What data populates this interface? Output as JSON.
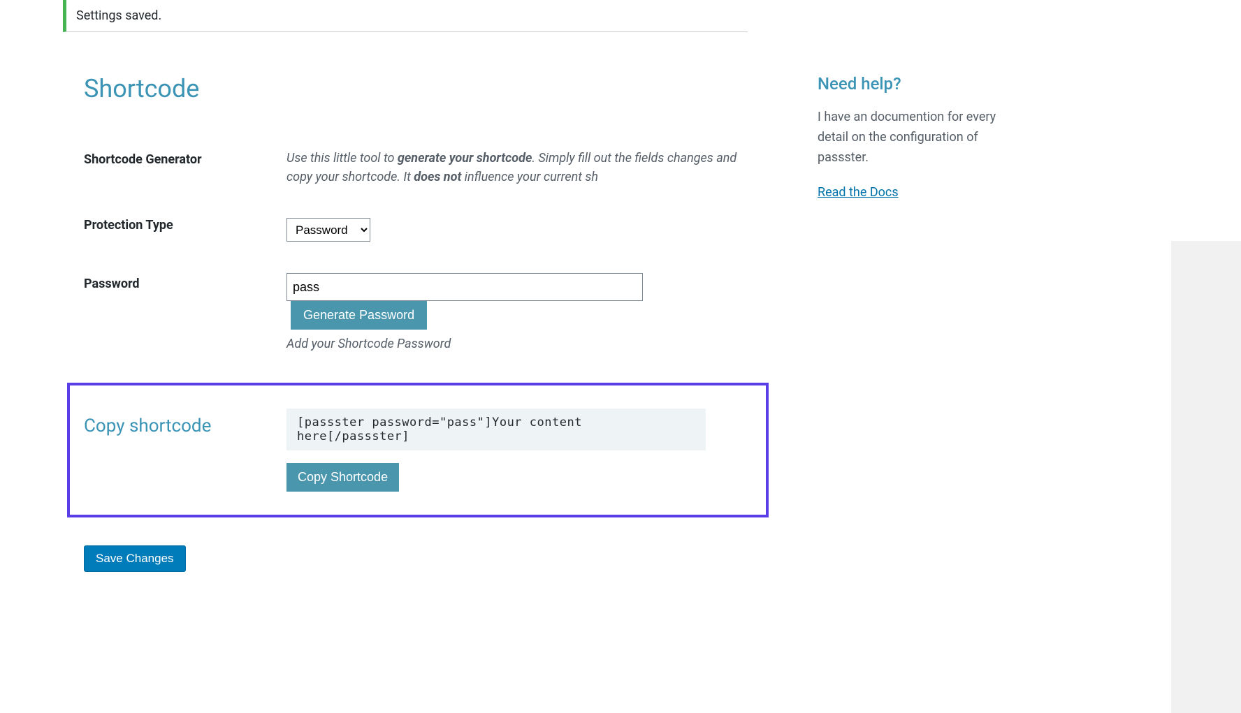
{
  "notice": {
    "message": "Settings saved."
  },
  "section": {
    "title": "Shortcode"
  },
  "generator": {
    "label": "Shortcode Generator",
    "desc_prefix": "Use this little tool to ",
    "desc_bold1": "generate your shortcode",
    "desc_mid": ". Simply fill out the fields changes and copy your shortcode. It ",
    "desc_bold2": "does not",
    "desc_suffix": " influence your current sh"
  },
  "protection": {
    "label": "Protection Type",
    "selected": "Password"
  },
  "password": {
    "label": "Password",
    "value": "pass",
    "generate_button": "Generate Password",
    "hint": "Add your Shortcode Password"
  },
  "copy": {
    "label": "Copy shortcode",
    "shortcode_text": "[passster password=\"pass\"]Your content here[/passster]",
    "button": "Copy Shortcode"
  },
  "submit": {
    "label": "Save Changes"
  },
  "help": {
    "title": "Need help?",
    "text": "I have an documention for every detail on the configuration of passster.",
    "link": "Read the Docs"
  }
}
